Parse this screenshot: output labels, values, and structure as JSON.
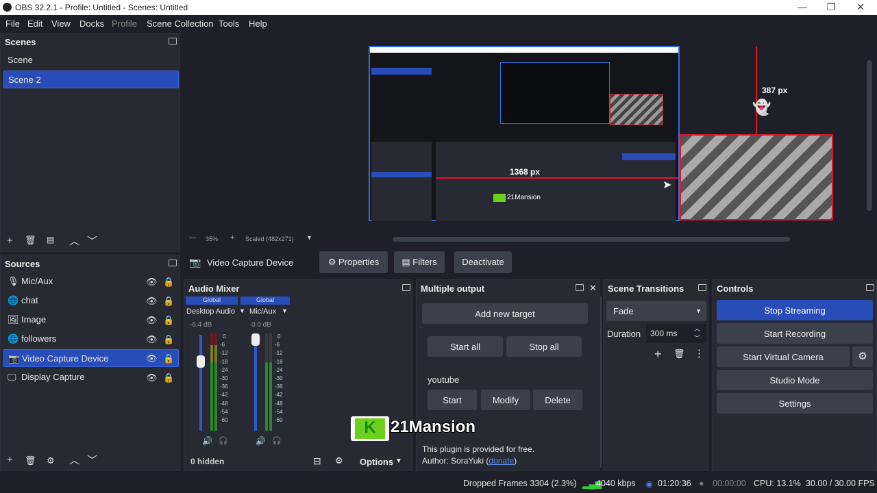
{
  "window": {
    "title": "OBS 32.2.1 - Profile: Untitled - Scenes: Untitled",
    "minimize": "—",
    "maximize": "❐",
    "close": "✕"
  },
  "menu": [
    "File",
    "Edit",
    "View",
    "Docks",
    "Profile",
    "Scene Collection",
    "Tools",
    "Help"
  ],
  "scenes": {
    "title": "Scenes",
    "items": [
      "Scene",
      "Scene 2"
    ],
    "selected": "Scene 2"
  },
  "preview": {
    "zoom": "35%",
    "scaled": "Scaled (482x271)",
    "measure_h": "1368 px",
    "measure_v": "387 px",
    "inner_watermark": "21Mansion"
  },
  "source_bar": {
    "source": "Video Capture Device",
    "properties": "Properties",
    "filters": "Filters",
    "deactivate": "Deactivate"
  },
  "sources": {
    "title": "Sources",
    "items": [
      "Mic/Aux",
      "chat",
      "Image",
      "followers",
      "Video Capture Device",
      "Display Capture"
    ],
    "selected": "Video Capture Device"
  },
  "audio_mixer": {
    "title": "Audio Mixer",
    "channels": [
      {
        "scope": "Global",
        "name": "Desktop Audio",
        "db": "-6.4 dB",
        "level": 0.72
      },
      {
        "scope": "Global",
        "name": "Mic/Aux",
        "db": "0.0 dB",
        "level": 0.9
      }
    ],
    "ticks": [
      "0",
      "-6",
      "-12",
      "-18",
      "-24",
      "-30",
      "-36",
      "-42",
      "-48",
      "-54",
      "-60"
    ],
    "hidden": "0 hidden",
    "options": "Options"
  },
  "multiple_output": {
    "title": "Multiple output",
    "add_target": "Add new target",
    "start_all": "Start all",
    "stop_all": "Stop all",
    "target": "youtube",
    "start": "Start",
    "modify": "Modify",
    "delete": "Delete",
    "info": "This plugin is provided for free.",
    "author_prefix": "Author: SoraYuki (",
    "donate": "donate",
    "author_suffix": ")"
  },
  "watermark": {
    "k": "K",
    "text": "21Mansion"
  },
  "transitions": {
    "title": "Scene Transitions",
    "selected": "Fade",
    "duration_label": "Duration",
    "duration": "300 ms"
  },
  "controls": {
    "title": "Controls",
    "stop_streaming": "Stop Streaming",
    "start_recording": "Start Recording",
    "start_virtual_camera": "Start Virtual Camera",
    "studio_mode": "Studio Mode",
    "settings": "Settings"
  },
  "status": {
    "dropped": "Dropped Frames 3304 (2.3%)",
    "bitrate": "4040 kbps",
    "stream_time": "01:20:36",
    "rec_time": "00:00:00",
    "cpu": "CPU: 13.1%",
    "fps": "30.00 / 30.00 FPS"
  },
  "colors": {
    "accent": "#284cb8",
    "bg": "#1e1f29",
    "panel": "#272a33",
    "button": "#3c404b",
    "selection_red": "#e0142a",
    "watermark_green": "#6cd11c"
  }
}
